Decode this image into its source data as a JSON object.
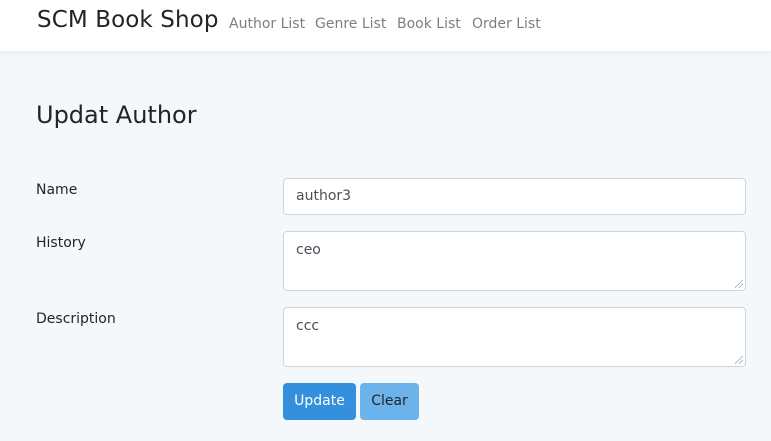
{
  "navbar": {
    "brand": "SCM Book Shop",
    "links": [
      {
        "label": "Author List"
      },
      {
        "label": "Genre List"
      },
      {
        "label": "Book List"
      },
      {
        "label": "Order List"
      }
    ]
  },
  "page": {
    "title": "Updat Author"
  },
  "form": {
    "name": {
      "label": "Name",
      "value": "author3"
    },
    "history": {
      "label": "History",
      "value": "ceo"
    },
    "description": {
      "label": "Description",
      "value": "ccc"
    },
    "update_label": "Update",
    "clear_label": "Clear"
  },
  "colors": {
    "primary": "#3490dc",
    "info": "#6cb2eb",
    "background": "#f5f8fa"
  }
}
